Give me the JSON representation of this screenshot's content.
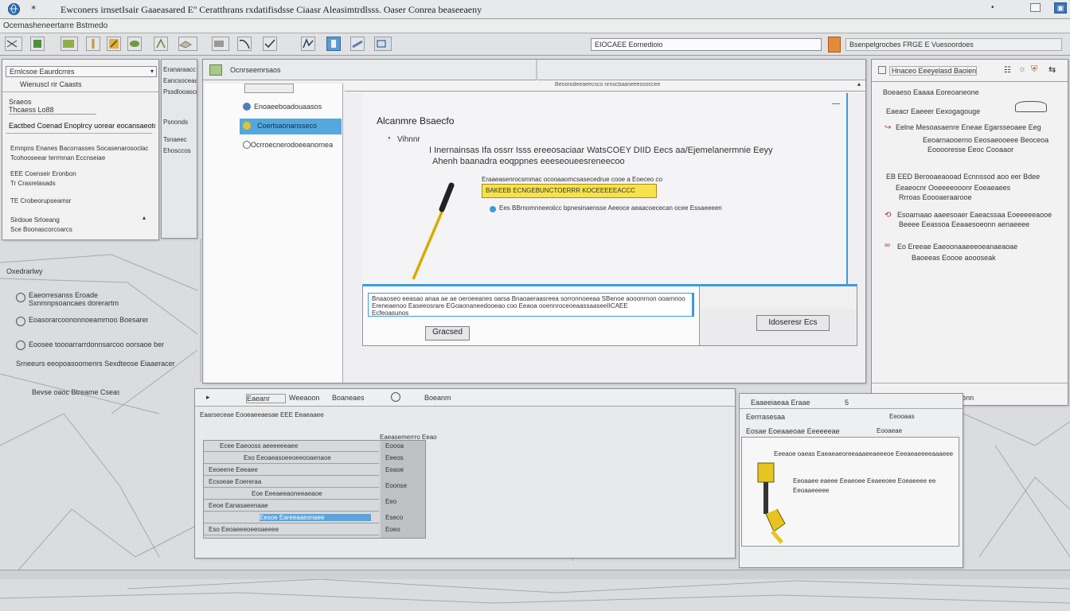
{
  "window": {
    "title": "Ewconers irnsetIsair Gaaeasared E'' Ceratthrans rxdatifisdsse Ciaasr Aleasimtrdlsss. Oaser Conrea beaseeaeny",
    "app_icon": "globe-icon",
    "minimize_icon": "minimize-icon",
    "maximize_icon": "maximize-icon",
    "settings_icon": "settings-icon"
  },
  "menubar": {
    "label": "Ocemasheneertarre   Bstmedo"
  },
  "toolbar": {
    "tools": [
      {
        "name": "pen-tool-icon"
      },
      {
        "name": "layer-tool-icon"
      },
      {
        "name": "fill-tool-icon"
      },
      {
        "name": "leaf-tool-icon"
      },
      {
        "name": "brush-tool-icon"
      },
      {
        "name": "eraser-tool-icon"
      },
      {
        "name": "frame-tool-icon"
      },
      {
        "name": "wave-tool-icon"
      },
      {
        "name": "check-tool-icon"
      },
      {
        "name": "pointer-tool-icon"
      },
      {
        "name": "curve-tool-icon"
      },
      {
        "name": "select-tool-icon"
      },
      {
        "name": "ruler-tool-icon"
      },
      {
        "name": "text-tool-icon"
      }
    ],
    "search_label": "EIOCAEE Eornedioio",
    "right_label": "Bsenpelgrocbes  FRGE  E Vuesoordoes"
  },
  "left_panel": {
    "dropdown": "Ernlcsoe Eaurdcrres",
    "sub1": "Wienuscl rir Caasts",
    "tab1": "Sraeos",
    "tab2": "Thcaess   Lo88",
    "heading": "Eactbed Coenad Enoplrcy uorear eocansaeoto",
    "items": [
      "Ernnpns  Enanes  Bacorrasses  Socasenarosoclac",
      "Tcohooseear  terrmnan Eccnseiae",
      "EEE  Coenseir Eronbon",
      "Tr  Crasrelasads",
      "TE  Crobeorupseamsr",
      "Sirdoue   Srloeang",
      "Sce  Boonascorcoarcs"
    ],
    "side_labels": [
      "Eranaraacc",
      "Eancsoceaaa",
      "Pssdlooascr",
      "Psnonds",
      "Tsnaeec",
      "Ehosccos"
    ],
    "lower_heading": "Oxedrarlwy",
    "lower_items": [
      "Eaeorresanss  Eroade",
      "Sxnmnpsoancaes dorerartm",
      "Eoasorarcoononnoeamrnoo Boesarer",
      "Eoosee  toooarrarrdonnsarcoo  oorsaoe  bemarg ouenoo",
      "Srneeurs  eeopoasoomenrs  Sexdteose  Eiaaeraceneaenr",
      "Bevse  oaoc  Btreame  Cseasassge"
    ]
  },
  "dialog": {
    "title": "Ocnrseemrsaos",
    "nav": [
      {
        "label": "Enoaeeboadouaasos",
        "icon": "folder-icon"
      },
      {
        "label": "Coertsaonansseco",
        "icon": "star-icon"
      },
      {
        "label": "Ocrroecnerodoeeanornea",
        "icon": "sync-icon"
      }
    ],
    "top_label": "Beoorodeeaeecsco nrnscbaaneeessoccee",
    "content_title": "Alcanmre Bsaecfo",
    "step_label": "Vihnnr",
    "message_line1": "I  Inernainsas Ifa ossrr Isss ereeosaciaar WatsCOEY DIID Eecs aa/Ejemelanermnie Eeyy",
    "message_line2": "Ahenh baanadra eoqppnes eeeseoueesreneecoo",
    "field_label": "Eraaeasenrocsmmac ocooaaomcsasecedrue cooe a  Eoeceo  co",
    "field_value": "BAKEEB  ECNGEBUNCTOERRR  KOCEEEEEACCC",
    "option_label": "Ees  BBrnomnneeoiicc bpnesinaensse  Aeeoce  aeaacoececan ocee  Essaeeeensaeese",
    "inline_text1": "Bnaaoseo  eeasao  anaa ae  ae  oeroeeanes oarsa  Bnaoaeraasreea sorronnoeeaa  SBenoe aooonrnon  ooarnnoo",
    "inline_text2": "Ereneaenoo Easeeosrare  EGoaonaneedooeao coo  Eeaoa  ooennroceoeaassaaseeIICAEE",
    "inline_text3": "Ecfeoasunos",
    "inline_button": "Gracsed",
    "right_button": "Idoseresr Ecs"
  },
  "right_panel": {
    "header": "Hnaceo  Eeeyelasd  Baoiennsatae",
    "icons": [
      "grid-icon",
      "sun-icon",
      "shield-icon",
      "transfer-icon"
    ],
    "heading": "Boeaeso  Eaaaa  Eoreoaneone",
    "items": [
      "Eaeacr  Eaeeer  Eexogagouge",
      "Eelne  Mesoasaenre  Eneae  Egarsseoaee  Eeg",
      "Eeoarnaooerno  Eeosaeooeee  Beoceoa",
      "Eooooresse  Eeoc  Cooaaor",
      "EB  EED  Berooaeaooad  Ecnnssod  aoo  eer  Bdee",
      "Eeaeocnr  Ooeeeeooonr  Eoeaeaees",
      "Rrroas  Eoooaeraarooe",
      "Esoarnaao aaeesoaer  Eaeacssaa  Eoeeeeeaooe",
      "Beeee  Eeassoa  Eeaaesoeonn  aenaeeee",
      "Eo  Ereeae  Eaeoonaaeeeoeanaeaoae",
      "Baoeeas  Eoooe  aoooseak"
    ],
    "footer": "Spesee  Esaeceo  Br  Baonn"
  },
  "lower_center": {
    "tabs": [
      "Eaeanr",
      "Weeaoon",
      "Boaneaes",
      "Boeanm"
    ],
    "header_row": "Eaarseceae  Eooeaeeaesae  EEE  Eeaeaaee",
    "subheader": "Eaeasemerrro  Eeao",
    "rows": [
      "Ecee  Eaeooss  aeeeeeeaee",
      "Eso  Eeoaeasoeeoeeooaenaoe",
      "Eeoeene  Eeeaee",
      "Ecsoeae  Eoereraa",
      "Eoe  Eeeaeeaoneeaeaoe",
      "Eeoe  Eanasaeenaae",
      "Eesoe  Eareeaaesnaee",
      "Eso  Eeoaeeeoeeoaeeee"
    ],
    "right_values": [
      "Eoooa",
      "Eeeos",
      "Eeaoe",
      "Eoonse",
      "Eeo",
      "Eseco",
      "Eoeo"
    ]
  },
  "lower_right": {
    "title": "Eaaeeiaeaa  Eraae",
    "subtitle": "Eerrrasesaa",
    "count": "5",
    "label": "Eeooaas",
    "section": "Eosae  Eoeaaeoae  Eeeeeeae",
    "section_right": "Eooaeae",
    "item1": "Eeeaoe  oaeas  Eaeaeaeoreeaaaeeaeeeoe  Eeeaeaeeeeaaaeee",
    "item2": "Eeoaaee  eaeee  Eeaeoee  Eeaeeoee  Eoeaeeee  ee",
    "item3": "Eeoaaeeeee"
  },
  "colors": {
    "accent_blue": "#3a9be0",
    "selection_blue": "#55a8de",
    "highlight_yellow": "#f7e24d",
    "tool_yellow": "#e8c421",
    "panel_bg": "#f2f2f3",
    "window_bg": "#dadcdf"
  }
}
